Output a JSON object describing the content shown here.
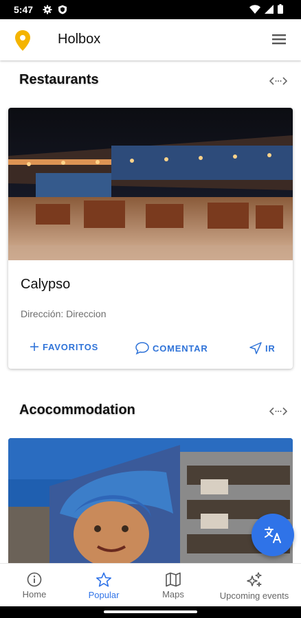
{
  "status_bar": {
    "time": "5:47"
  },
  "app_bar": {
    "title": "Holbox"
  },
  "sections": {
    "restaurants": {
      "title": "Restaurants",
      "card": {
        "name": "Calypso",
        "address": "Dirección: Direccion",
        "actions": {
          "favorite": "FAVORITOS",
          "comment": "COMENTAR",
          "go": "IR"
        }
      }
    },
    "accommodation": {
      "title": "Acocommodation"
    }
  },
  "bottom_nav": {
    "items": [
      {
        "label": "Home",
        "icon": "info-icon"
      },
      {
        "label": "Popular",
        "icon": "star-icon",
        "active": true
      },
      {
        "label": "Maps",
        "icon": "map-icon"
      },
      {
        "label": "Upcoming events",
        "icon": "sparkles-icon"
      }
    ]
  },
  "colors": {
    "accent": "#2f73e8",
    "pin": "#f4b400"
  }
}
